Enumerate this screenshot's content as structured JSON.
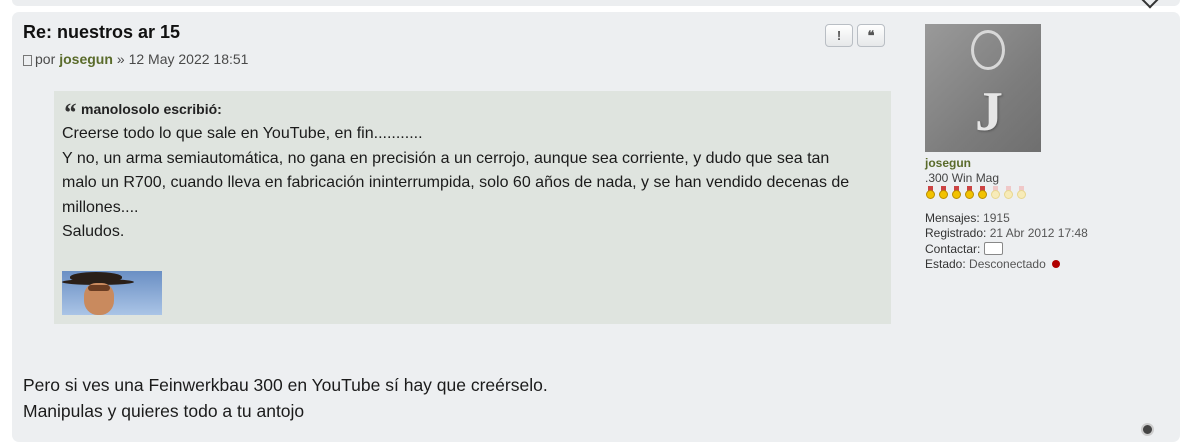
{
  "post": {
    "title": "Re: nuestros ar 15",
    "meta": {
      "by": "por",
      "author": "josegun",
      "date": "» 12 May 2022 18:51"
    },
    "buttons": {
      "report": "!",
      "quote": "❝"
    }
  },
  "quote": {
    "author": "manolosolo escribió:",
    "lines": [
      "Creerse todo lo que sale en YouTube, en fin...........",
      "Y no, un arma semiautomática, no gana en precisión a un cerrojo, aunque sea corriente, y dudo que sea tan",
      "malo un R700, cuando lleva en fabricación ininterrumpida, solo 60 años de nada, y se han vendido decenas de",
      "millones....",
      "Saludos."
    ]
  },
  "body": {
    "lines": [
      "Pero si ves una Feinwerkbau 300 en YouTube sí hay que creérselo.",
      "Manipulas y quieres todo a tu antojo"
    ]
  },
  "profile": {
    "username": "josegun",
    "rank": ".300 Win Mag",
    "medals": {
      "filled": 5,
      "total": 8
    },
    "posts_label": "Mensajes:",
    "posts": "1915",
    "registered_label": "Registrado:",
    "registered": "21 Abr 2012 17:48",
    "contact_label": "Contactar:",
    "status_label": "Estado:",
    "status": "Desconectado",
    "status_color": "#b00000"
  }
}
